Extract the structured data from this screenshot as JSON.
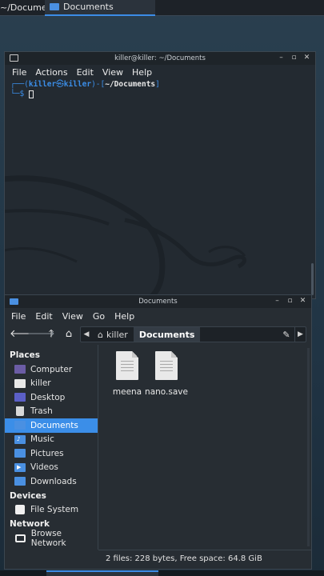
{
  "taskbar": {
    "tasks": [
      {
        "label": "~/Documents"
      },
      {
        "label": "Documents"
      }
    ]
  },
  "terminal": {
    "title": "killer@killer: ~/Documents",
    "menu": [
      "File",
      "Actions",
      "Edit",
      "View",
      "Help"
    ],
    "prompt": {
      "open": "┌──(",
      "user": "killer",
      "at": "㉿",
      "host": "killer",
      "mid": ")-[",
      "path": "~/Documents",
      "close": "]",
      "line2": "└─$"
    }
  },
  "file_manager": {
    "title": "Documents",
    "menu": [
      "File",
      "Edit",
      "View",
      "Go",
      "Help"
    ],
    "path": {
      "segments": [
        {
          "label": "killer",
          "icon": "home-icon"
        },
        {
          "label": "Documents"
        }
      ]
    },
    "sidebar": {
      "places_label": "Places",
      "places": [
        {
          "label": "Computer",
          "icon": "computer-icon"
        },
        {
          "label": "killer",
          "icon": "home-folder-icon"
        },
        {
          "label": "Desktop",
          "icon": "desktop-folder-icon"
        },
        {
          "label": "Trash",
          "icon": "trash-icon"
        },
        {
          "label": "Documents",
          "icon": "documents-folder-icon",
          "selected": true
        },
        {
          "label": "Music",
          "icon": "music-folder-icon"
        },
        {
          "label": "Pictures",
          "icon": "pictures-folder-icon"
        },
        {
          "label": "Videos",
          "icon": "videos-folder-icon"
        },
        {
          "label": "Downloads",
          "icon": "downloads-folder-icon"
        }
      ],
      "devices_label": "Devices",
      "devices": [
        {
          "label": "File System",
          "icon": "drive-icon"
        }
      ],
      "network_label": "Network",
      "network": [
        {
          "label": "Browse Network",
          "icon": "network-icon"
        }
      ]
    },
    "files": [
      {
        "name": "meena",
        "icon": "text-file-icon"
      },
      {
        "name": "nano.save",
        "icon": "text-file-icon"
      }
    ],
    "status": "2 files: 228 bytes, Free space: 64.8 GiB"
  },
  "colors": {
    "accent": "#3b8ee8",
    "terminal_bg": "#232a31",
    "window_bg": "#272d33"
  }
}
